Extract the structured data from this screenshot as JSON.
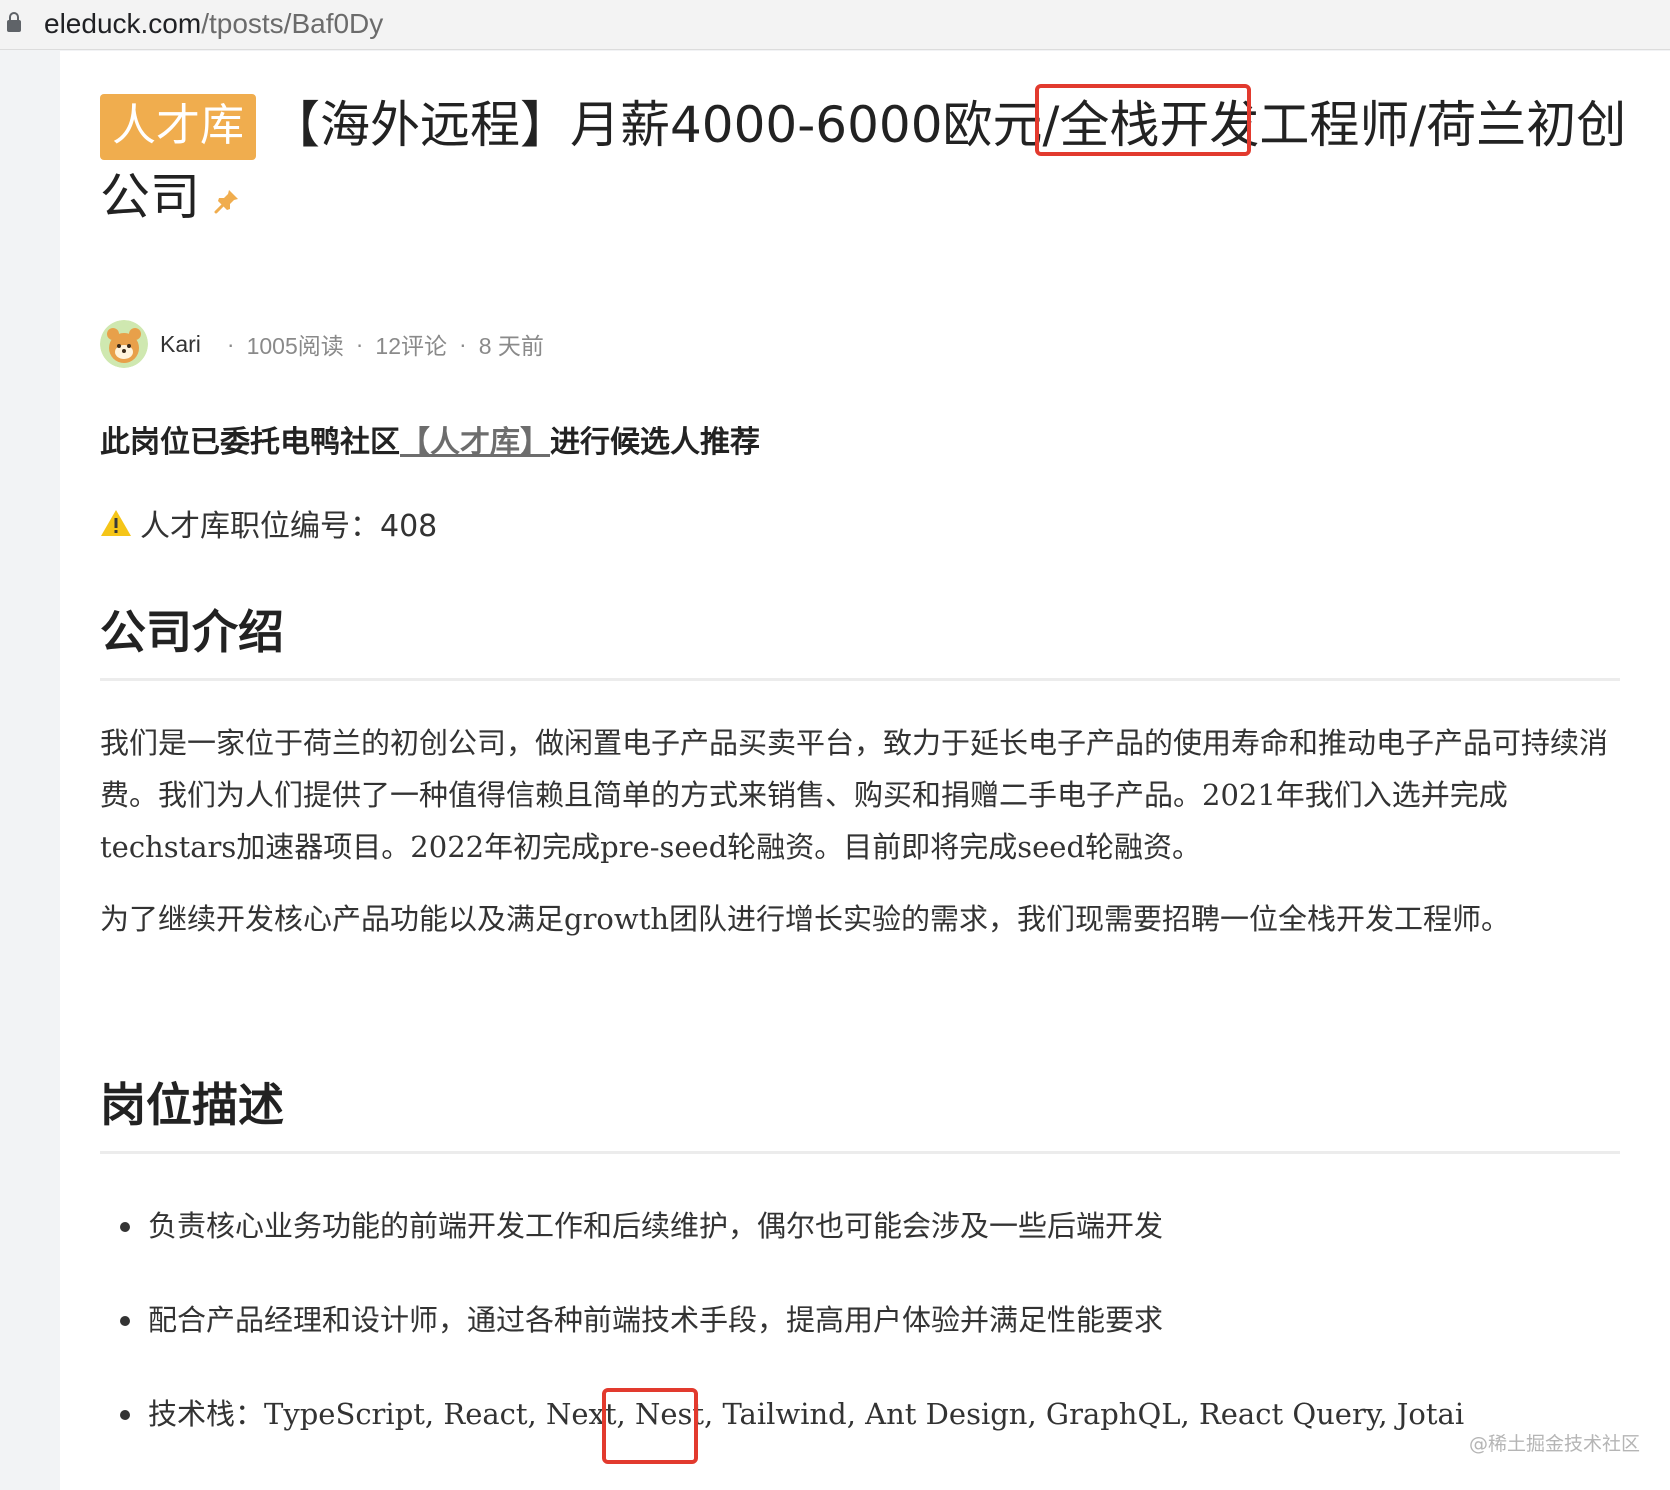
{
  "browser": {
    "url_host": "eleduck.com",
    "url_path": "/tposts/Baf0Dy"
  },
  "post": {
    "badge": "人才库",
    "title": "【海外远程】月薪4000-6000欧元/全栈开发工程师/荷兰初创公司",
    "author": "Kari",
    "reads": "1005阅读",
    "comments": "12评论",
    "time": "8 天前",
    "delegation_prefix": "此岗位已委托电鸭社区",
    "delegation_link": "【人才库】",
    "delegation_suffix": "进行候选人推荐",
    "job_number": "人才库职位编号：408"
  },
  "sections": {
    "company_heading": "公司介绍",
    "company_para1": "我们是一家位于荷兰的初创公司，做闲置电子产品买卖平台，致力于延长电子产品的使用寿命和推动电子产品可持续消费。我们为人们提供了一种值得信赖且简单的方式来销售、购买和捐赠二手电子产品。2021年我们入选并完成techstars加速器项目。2022年初完成pre-seed轮融资。目前即将完成seed轮融资。",
    "company_para2": "为了继续开发核心产品功能以及满足growth团队进行增长实验的需求，我们现需要招聘一位全栈开发工程师。",
    "job_heading": "岗位描述",
    "job_items": [
      "负责核心业务功能的前端开发工作和后续维护，偶尔也可能会涉及一些后端开发",
      "配合产品经理和设计师，通过各种前端技术手段，提高用户体验并满足性能要求",
      "技术栈：TypeScript, React, Next, Nest, Tailwind, Ant Design, GraphQL, React Query, Jotai"
    ]
  },
  "watermark": "@稀土掘金技术社区",
  "colors": {
    "badge": "#f0ad4e",
    "highlight": "#e23a2e",
    "pin": "#f0ad4e"
  },
  "icons": [
    "lock-icon",
    "pin-icon",
    "avatar",
    "warning-icon"
  ]
}
